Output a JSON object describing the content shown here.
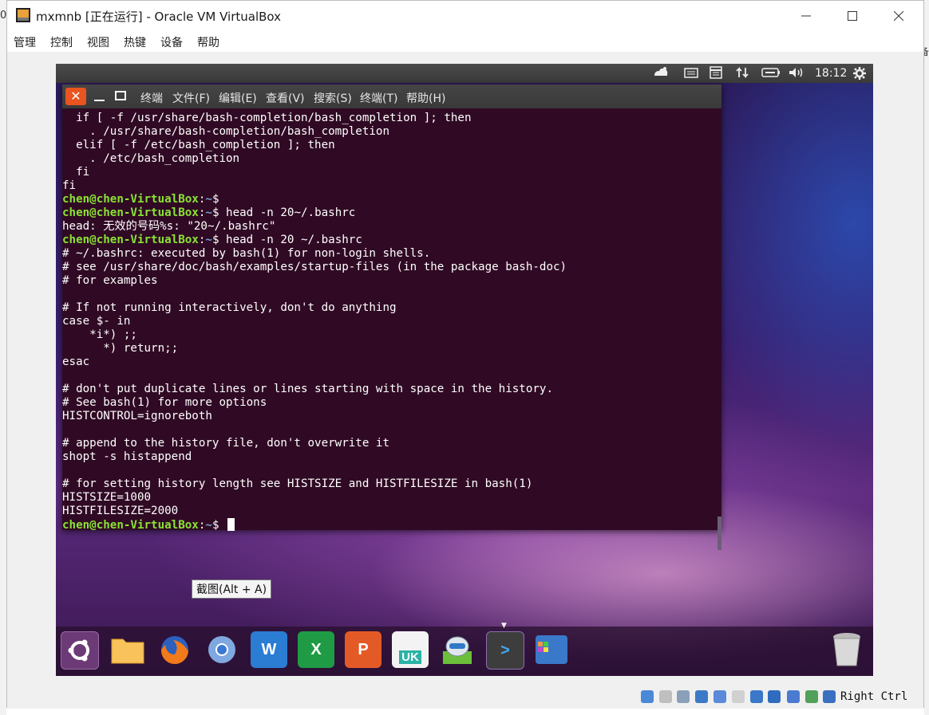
{
  "host": {
    "title": "mxmnb [正在运行] - Oracle VM VirtualBox",
    "left_edge_glyph": "0",
    "right_edge_glyph": "备",
    "menu": [
      "管理",
      "控制",
      "视图",
      "热键",
      "设备",
      "帮助"
    ],
    "right_ctrl_label": "Right Ctrl"
  },
  "guest": {
    "clock": "18:12",
    "tooltip": "截图(Alt + A)"
  },
  "terminal": {
    "close_glyph": "✕",
    "menu": [
      "终端",
      "文件(F)",
      "编辑(E)",
      "查看(V)",
      "搜索(S)",
      "终端(T)",
      "帮助(H)"
    ],
    "prompt_user": "chen@chen-VirtualBox",
    "prompt_sep": ":",
    "prompt_path": "~",
    "prompt_suffix": "$ ",
    "lines": [
      {
        "text": "  if [ -f /usr/share/bash-completion/bash_completion ]; then"
      },
      {
        "text": "    . /usr/share/bash-completion/bash_completion"
      },
      {
        "text": "  elif [ -f /etc/bash_completion ]; then"
      },
      {
        "text": "    . /etc/bash_completion"
      },
      {
        "text": "  fi"
      },
      {
        "text": "fi"
      },
      {
        "prompt": true,
        "text": ""
      },
      {
        "prompt": true,
        "text": "head -n 20~/.bashrc"
      },
      {
        "text": "head: 无效的号码%s: \"20~/.bashrc\""
      },
      {
        "prompt": true,
        "text": "head -n 20 ~/.bashrc"
      },
      {
        "text": "# ~/.bashrc: executed by bash(1) for non-login shells."
      },
      {
        "text": "# see /usr/share/doc/bash/examples/startup-files (in the package bash-doc)"
      },
      {
        "text": "# for examples"
      },
      {
        "text": ""
      },
      {
        "text": "# If not running interactively, don't do anything"
      },
      {
        "text": "case $- in"
      },
      {
        "text": "    *i*) ;;"
      },
      {
        "text": "      *) return;;"
      },
      {
        "text": "esac"
      },
      {
        "text": ""
      },
      {
        "text": "# don't put duplicate lines or lines starting with space in the history."
      },
      {
        "text": "# See bash(1) for more options"
      },
      {
        "text": "HISTCONTROL=ignoreboth"
      },
      {
        "text": ""
      },
      {
        "text": "# append to the history file, don't overwrite it"
      },
      {
        "text": "shopt -s histappend"
      },
      {
        "text": ""
      },
      {
        "text": "# for setting history length see HISTSIZE and HISTFILESIZE in bash(1)"
      },
      {
        "text": "HISTSIZE=1000"
      },
      {
        "text": "HISTFILESIZE=2000"
      },
      {
        "prompt": true,
        "text": "",
        "cursor": true
      }
    ]
  },
  "launcher": {
    "items": [
      {
        "name": "ubuntu-dash-icon",
        "label": "",
        "color": "#6c3a77"
      },
      {
        "name": "files-icon",
        "label": "",
        "color": "#f4a93a"
      },
      {
        "name": "firefox-icon",
        "label": "",
        "color": "#e8582a"
      },
      {
        "name": "chromium-icon",
        "label": "",
        "color": "#5b8fd6"
      },
      {
        "name": "wps-writer-icon",
        "label": "W",
        "color": "#2b7cd3"
      },
      {
        "name": "wps-spreadsheets-icon",
        "label": "X",
        "color": "#1f9b45"
      },
      {
        "name": "wps-presentation-icon",
        "label": "P",
        "color": "#e45a26"
      },
      {
        "name": "uk-software-icon",
        "label": "UK",
        "color": "#e8e8e8"
      },
      {
        "name": "software-updater-icon",
        "label": "",
        "color": "#5aa830"
      },
      {
        "name": "terminal-icon",
        "label": ">",
        "color": "#4a4a4a"
      },
      {
        "name": "workspace-switcher-icon",
        "label": "",
        "color": "#3a6fbf"
      }
    ],
    "trash_label": ""
  }
}
